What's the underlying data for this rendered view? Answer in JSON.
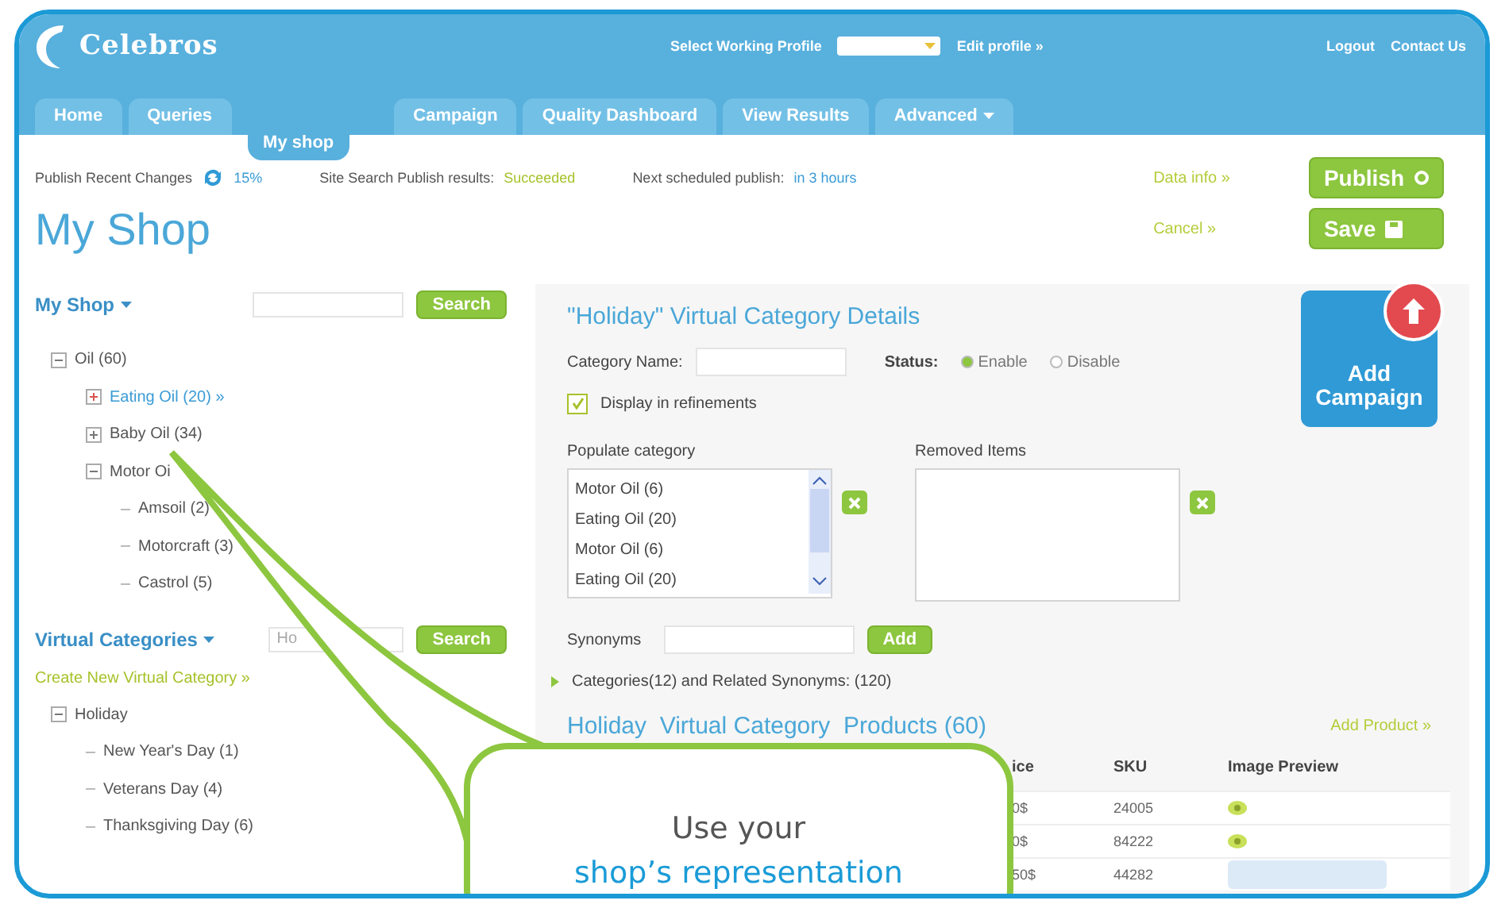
{
  "header": {
    "logo": "Celebros",
    "profile_label": "Select Working Profile",
    "edit_profile": "Edit profile »",
    "links": [
      "Logout",
      "Contact Us"
    ]
  },
  "tabs": [
    {
      "label": "Home",
      "selected": false,
      "kind": "plain"
    },
    {
      "label": "Queries",
      "selected": false,
      "kind": "plain"
    },
    {
      "label": "My shop",
      "selected": true,
      "kind": "plain"
    },
    {
      "label": "Campaign",
      "selected": false,
      "kind": "plain"
    },
    {
      "label": "Quality Dashboard",
      "selected": false,
      "kind": "plain"
    },
    {
      "label": "View Results",
      "selected": false,
      "kind": "plain"
    },
    {
      "label": "Advanced",
      "selected": false,
      "kind": "menu"
    }
  ],
  "status": {
    "publish_label": "Publish Recent Changes",
    "publish_percent": "15%",
    "site_search_label": "Site Search Publish results:",
    "site_search_value": "Succeeded",
    "next_label": "Next scheduled publish:",
    "next_value": "in 3 hours",
    "data_info": "Data info »",
    "cancel": "Cancel »"
  },
  "buttons": [
    {
      "label": "Publish",
      "kind": "publish"
    },
    {
      "label": "Save",
      "kind": "save"
    }
  ],
  "page_title": "My Shop",
  "shop_tree": {
    "title": "My Shop",
    "search_button": "Search",
    "items": [
      {
        "label": "Oil (60)",
        "expanded": true,
        "selected": false,
        "children": [
          {
            "label": "Eating Oil (20) »",
            "expanded": false,
            "selected": true
          },
          {
            "label": "Baby Oil (34)",
            "expanded": false,
            "selected": false
          },
          {
            "label": "Motor Oi",
            "expanded": true,
            "selected": false,
            "children": [
              {
                "label": "Amsoil (2)",
                "selected": false
              },
              {
                "label": "Motorcraft (3)",
                "selected": false
              },
              {
                "label": "Castrol (5)",
                "selected": false
              }
            ]
          }
        ]
      }
    ]
  },
  "virtual_categories": {
    "title": "Virtual Categories",
    "search_placeholder": "Ho",
    "search_button": "Search",
    "create_link": "Create New Virtual Category »",
    "items": [
      {
        "label": "Holiday",
        "expanded": true,
        "selected": false,
        "children": [
          {
            "label": "New Year's Day (1)",
            "selected": false
          },
          {
            "label": "Veterans Day (4)",
            "selected": false
          },
          {
            "label": "Thanksgiving Day (6)",
            "selected": false
          }
        ]
      }
    ]
  },
  "details": {
    "title": "\"Holiday\" Virtual Category Details",
    "category_name_label": "Category Name:",
    "status_label": "Status:",
    "status_options": [
      {
        "label": "Enable",
        "selected": true
      },
      {
        "label": "Disable",
        "selected": false
      }
    ],
    "display_in_refinements": {
      "label": "Display in refinements",
      "checked": true
    },
    "populate_label": "Populate category",
    "populate_items": [
      "Motor Oil (6)",
      "Eating Oil (20)",
      "Motor Oil (6)",
      "Eating Oil (20)"
    ],
    "removed_label": "Removed Items",
    "synonyms_label": "Synonyms",
    "add_button": "Add",
    "related": "Categories(12) and Related Synonyms: (120)",
    "add_campaign": "Add Campaign"
  },
  "products": {
    "title": "Holiday  Virtual Category  Products (60)",
    "add_product": "Add Product »",
    "columns": [
      "ice",
      "SKU",
      "Image Preview"
    ],
    "rows": [
      {
        "price": "0$",
        "sku": "24005",
        "kind": "icon"
      },
      {
        "price": "0$",
        "sku": "84222",
        "kind": "icon"
      },
      {
        "price": "50$",
        "sku": "44282",
        "kind": "image"
      }
    ]
  },
  "callout": {
    "line_1": "Use your",
    "line_2": "shop’s representation"
  }
}
